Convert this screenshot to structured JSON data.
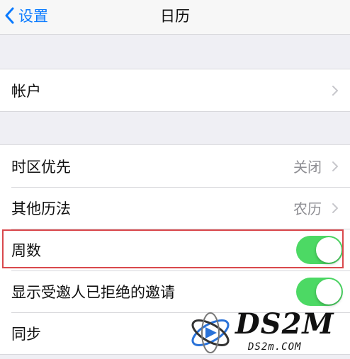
{
  "navbar": {
    "back_label": "设置",
    "title": "日历"
  },
  "group1": {
    "account_label": "帐户"
  },
  "group2": {
    "timezone_label": "时区优先",
    "timezone_value": "关闭",
    "calendar_label": "其他历法",
    "calendar_value": "农历",
    "week_numbers_label": "周数",
    "week_numbers_on": true,
    "declined_label": "显示受邀人已拒绝的邀请",
    "declined_on": true,
    "sync_label": "同步"
  },
  "watermark": {
    "brand": "DS2M",
    "domain": "DS2m.COM"
  },
  "colors": {
    "accent": "#0a7aff",
    "toggle_on": "#4cd964",
    "highlight": "#d9484c"
  }
}
